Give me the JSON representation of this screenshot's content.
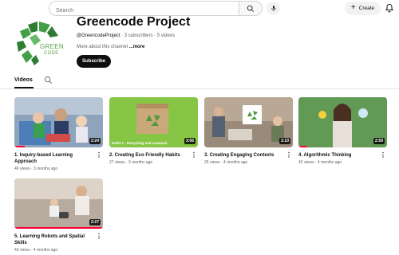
{
  "header": {
    "search_placeholder": "Search",
    "create_label": "Create"
  },
  "channel": {
    "logo_line1": "GREEN",
    "logo_line2": "CODE",
    "title": "Greencode Project",
    "handle": "@GreencodeProject",
    "stats": " · 3 subscribers · 5 videos",
    "description": "More about this channel ",
    "more_label": "...more",
    "subscribe_label": "Subscribe",
    "brand_color": "#5aa348"
  },
  "tabs": [
    {
      "label": "Videos",
      "active": true
    }
  ],
  "videos": [
    {
      "title": "1. Inquiry-based Learning Approach",
      "meta": "46 views · 3 months ago",
      "duration": "2:24",
      "progress": 0.12
    },
    {
      "title": "2. Creating Eco Friendly Habits",
      "meta": "27 views · 3 months ago",
      "duration": "3:06",
      "progress": 0.0,
      "caption": "Habit 1 - Recycling and compost"
    },
    {
      "title": "3. Creating Engaging Contexts",
      "meta": "26 views · 4 months ago",
      "duration": "3:10",
      "progress": 0.0
    },
    {
      "title": "4. Algorithmic Thinking",
      "meta": "42 views · 4 months ago",
      "duration": "2:59",
      "progress": 0.1
    },
    {
      "title": "5. Learning Robots and Spatial Skills",
      "meta": "43 views · 4 months ago",
      "duration": "2:27",
      "progress": 1.0
    }
  ]
}
